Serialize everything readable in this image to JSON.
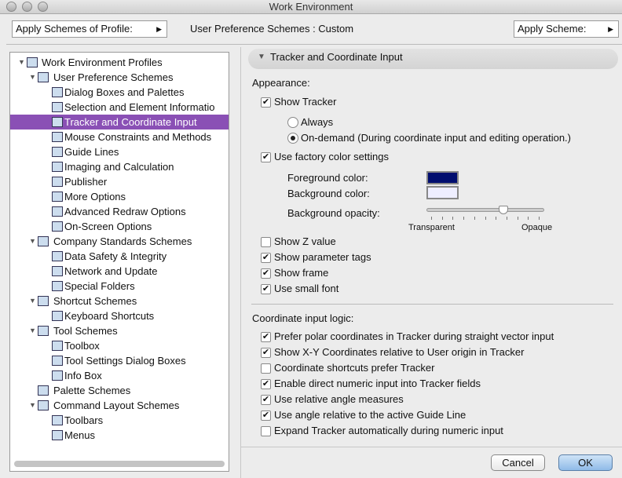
{
  "window": {
    "title": "Work Environment"
  },
  "toolbar": {
    "apply_profile": "Apply Schemes of Profile:",
    "current_scheme": "User Preference Schemes : Custom",
    "apply_scheme": "Apply Scheme:"
  },
  "tree": [
    {
      "label": "Work Environment Profiles",
      "level": 0,
      "expanded": true
    },
    {
      "label": "User Preference Schemes",
      "level": 1,
      "expanded": true
    },
    {
      "label": "Dialog Boxes and Palettes",
      "level": 2
    },
    {
      "label": "Selection and Element Informatio",
      "level": 2
    },
    {
      "label": "Tracker and Coordinate Input",
      "level": 2,
      "selected": true
    },
    {
      "label": "Mouse Constraints and Methods",
      "level": 2
    },
    {
      "label": "Guide Lines",
      "level": 2
    },
    {
      "label": "Imaging and Calculation",
      "level": 2
    },
    {
      "label": "Publisher",
      "level": 2
    },
    {
      "label": "More Options",
      "level": 2
    },
    {
      "label": "Advanced Redraw Options",
      "level": 2
    },
    {
      "label": "On-Screen Options",
      "level": 2
    },
    {
      "label": "Company Standards Schemes",
      "level": 1,
      "expanded": true
    },
    {
      "label": "Data Safety & Integrity",
      "level": 2
    },
    {
      "label": "Network and Update",
      "level": 2
    },
    {
      "label": "Special Folders",
      "level": 2
    },
    {
      "label": "Shortcut Schemes",
      "level": 1,
      "expanded": true
    },
    {
      "label": "Keyboard Shortcuts",
      "level": 2
    },
    {
      "label": "Tool Schemes",
      "level": 1,
      "expanded": true
    },
    {
      "label": "Toolbox",
      "level": 2
    },
    {
      "label": "Tool Settings Dialog Boxes",
      "level": 2
    },
    {
      "label": "Info Box",
      "level": 2
    },
    {
      "label": "Palette Schemes",
      "level": 1
    },
    {
      "label": "Command Layout Schemes",
      "level": 1,
      "expanded": true
    },
    {
      "label": "Toolbars",
      "level": 2
    },
    {
      "label": "Menus",
      "level": 2
    }
  ],
  "panel": {
    "title": "Tracker and Coordinate Input",
    "appearance_label": "Appearance:",
    "show_tracker": {
      "label": "Show Tracker",
      "checked": true
    },
    "radios": [
      {
        "label": "Always",
        "checked": false
      },
      {
        "label": "On-demand (During coordinate input and editing operation.)",
        "checked": true
      }
    ],
    "factory_colors": {
      "label": "Use factory color settings",
      "checked": true
    },
    "foreground_label": "Foreground color:",
    "foreground_color": "#000d6e",
    "background_label": "Background color:",
    "background_color": "#eeeeff",
    "opacity_label": "Background opacity:",
    "opacity_value": 0.65,
    "opacity_min": "Transparent",
    "opacity_max": "Opaque",
    "appearance_checks": [
      {
        "label": "Show Z value",
        "checked": false
      },
      {
        "label": "Show parameter tags",
        "checked": true
      },
      {
        "label": "Show frame",
        "checked": true
      },
      {
        "label": "Use small font",
        "checked": true
      }
    ],
    "logic_label": "Coordinate input logic:",
    "logic_checks": [
      {
        "label": "Prefer polar coordinates in Tracker during straight vector input",
        "checked": true
      },
      {
        "label": "Show X-Y Coordinates relative to User origin in Tracker",
        "checked": true
      },
      {
        "label": "Coordinate shortcuts prefer Tracker",
        "checked": false
      },
      {
        "label": "Enable direct numeric input into Tracker fields",
        "checked": true
      },
      {
        "label": "Use relative angle measures",
        "checked": true
      },
      {
        "label": "Use angle relative to the active Guide Line",
        "checked": true
      },
      {
        "label": "Expand Tracker automatically during numeric input",
        "checked": false
      }
    ]
  },
  "buttons": {
    "cancel": "Cancel",
    "ok": "OK"
  }
}
